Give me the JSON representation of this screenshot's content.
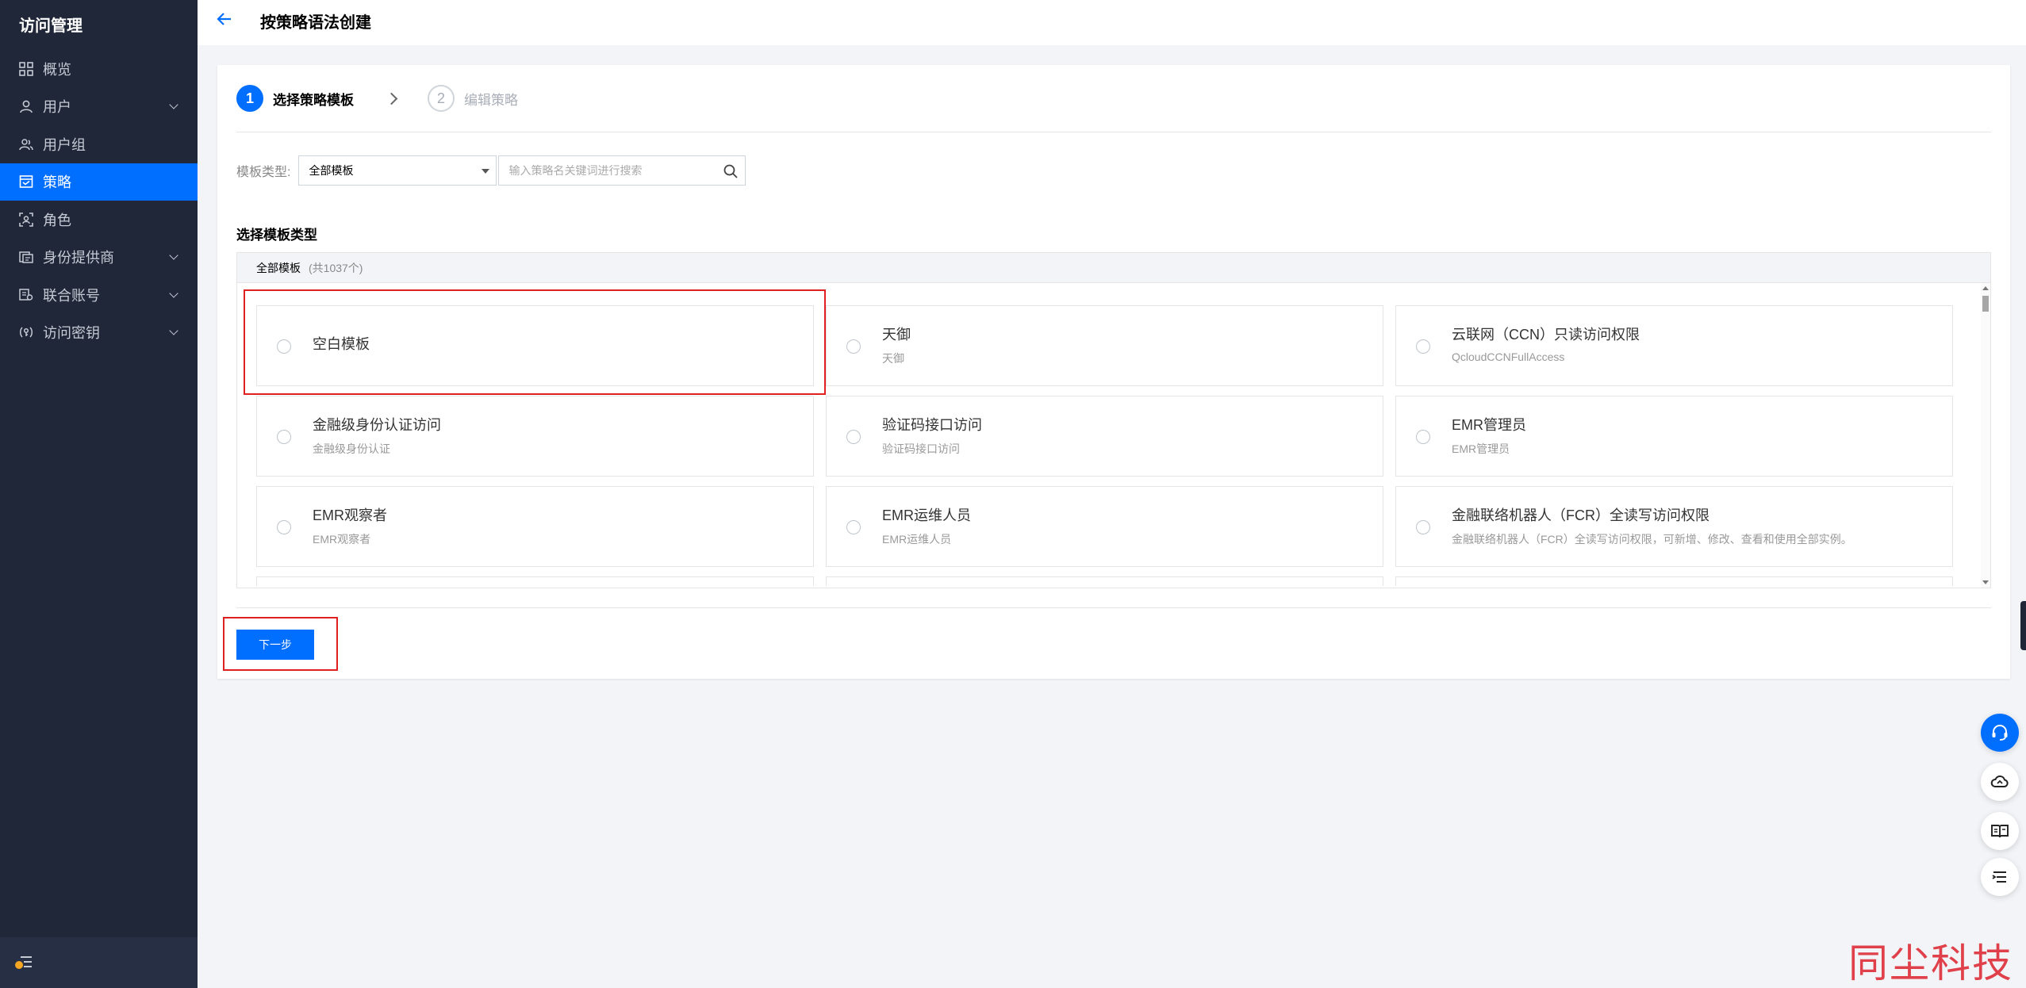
{
  "sidebar": {
    "title": "访问管理",
    "items": [
      {
        "label": "概览",
        "icon": "grid-icon"
      },
      {
        "label": "用户",
        "icon": "user-icon",
        "expandable": true
      },
      {
        "label": "用户组",
        "icon": "user-group-icon"
      },
      {
        "label": "策略",
        "icon": "policy-icon",
        "active": true
      },
      {
        "label": "角色",
        "icon": "role-icon"
      },
      {
        "label": "身份提供商",
        "icon": "identity-provider-icon",
        "expandable": true
      },
      {
        "label": "联合账号",
        "icon": "federated-account-icon",
        "expandable": true
      },
      {
        "label": "访问密钥",
        "icon": "access-key-icon",
        "expandable": true
      }
    ]
  },
  "header": {
    "title": "按策略语法创建"
  },
  "steps": [
    {
      "number": "1",
      "label": "选择策略模板",
      "active": true
    },
    {
      "number": "2",
      "label": "编辑策略",
      "active": false
    }
  ],
  "filter": {
    "label": "模板类型:",
    "selected": "全部模板",
    "search_placeholder": "输入策略名关键词进行搜索"
  },
  "section_title": "选择模板类型",
  "panel": {
    "header": "全部模板",
    "count": "(共1037个)"
  },
  "templates": [
    {
      "name": "空白模板",
      "desc": ""
    },
    {
      "name": "天御",
      "desc": "天御"
    },
    {
      "name": "云联网（CCN）只读访问权限",
      "desc": "QcloudCCNFullAccess"
    },
    {
      "name": "金融级身份认证访问",
      "desc": "金融级身份认证"
    },
    {
      "name": "验证码接口访问",
      "desc": "验证码接口访问"
    },
    {
      "name": "EMR管理员",
      "desc": "EMR管理员"
    },
    {
      "name": "EMR观察者",
      "desc": "EMR观察者"
    },
    {
      "name": "EMR运维人员",
      "desc": "EMR运维人员"
    },
    {
      "name": "金融联络机器人（FCR）全读写访问权限",
      "desc": "金融联络机器人（FCR）全读写访问权限，可新增、修改、查看和使用全部实例。"
    }
  ],
  "buttons": {
    "next": "下一步"
  },
  "watermark": "同尘科技",
  "colors": {
    "primary": "#006eff",
    "sidebar_bg": "#1f2738",
    "highlight_box": "#e02020"
  }
}
